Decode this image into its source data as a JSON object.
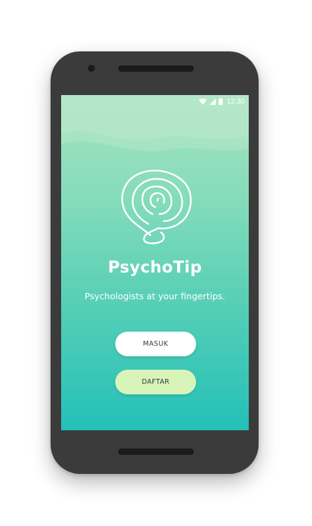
{
  "status_bar": {
    "time": "12:30",
    "icons": [
      "wifi-icon",
      "signal-icon",
      "battery-icon"
    ]
  },
  "app": {
    "name": "PsychoTip",
    "tagline": "Psychologists at your fingertips.",
    "logo_icon": "fingerprint-head-icon"
  },
  "buttons": {
    "login_label": "MASUK",
    "register_label": "DAFTAR"
  },
  "colors": {
    "gradient_top": "#a6e3c0",
    "gradient_bottom": "#24c0b8",
    "login_button": "#ffffff",
    "register_button": "#d9f4b9",
    "device_body": "#3b3b3c"
  }
}
